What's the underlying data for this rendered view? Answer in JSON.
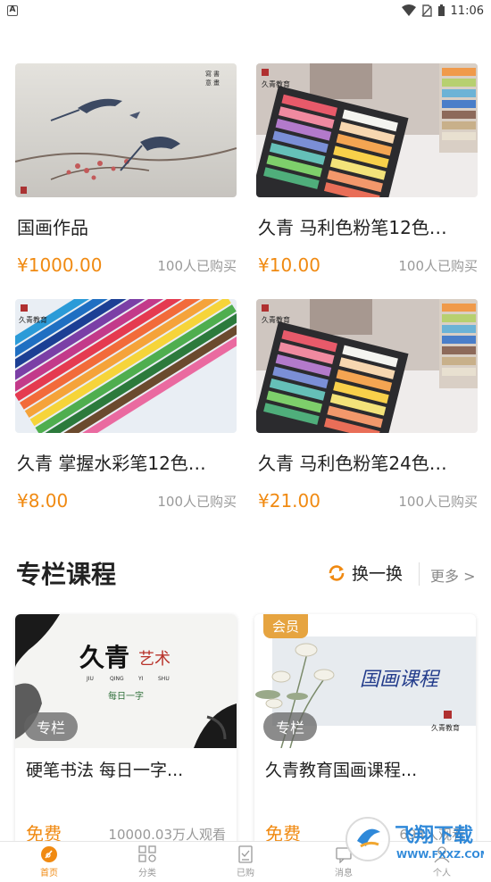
{
  "status_bar": {
    "time": "11:06",
    "left_icon": "A"
  },
  "products": [
    {
      "name": "国画作品",
      "price": "¥1000.00",
      "sold": "100人已购买"
    },
    {
      "name": "久青 马利色粉笔12色…",
      "price": "¥10.00",
      "sold": "100人已购买"
    },
    {
      "name": "久青 掌握水彩笔12色…",
      "price": "¥8.00",
      "sold": "100人已购买"
    },
    {
      "name": "久青 马利色粉笔24色…",
      "price": "¥21.00",
      "sold": "100人已购买"
    }
  ],
  "section": {
    "title": "专栏课程",
    "swap_label": "换一换",
    "more_label": "更多 >"
  },
  "courses": [
    {
      "title": "硬笔书法 每日一字...",
      "tag": "专栏",
      "price": "免费",
      "views": "10000.03万人观看",
      "thumb_texts": {
        "brand": "久青",
        "art": "艺术",
        "pinyin": [
          "JIU",
          "QING",
          "YI",
          "SHU"
        ],
        "sub": "每日一字"
      }
    },
    {
      "title": "久青教育国画课程...",
      "tag": "专栏",
      "vip": "会员",
      "price": "免费",
      "views": "694人观看",
      "thumb_texts": {
        "calligraphy": "国画课程",
        "seal": "久青教育"
      }
    }
  ],
  "bottom_nav": [
    {
      "label": "首页",
      "icon": "home-icon",
      "active": true
    },
    {
      "label": "分类",
      "icon": "category-grid-icon",
      "active": false
    },
    {
      "label": "已购",
      "icon": "purchased-icon",
      "active": false
    },
    {
      "label": "消息",
      "icon": "message-icon",
      "active": false
    },
    {
      "label": "个人",
      "icon": "profile-icon",
      "active": false
    }
  ],
  "watermark": {
    "text": "飞翔下载",
    "url": "WWW.FXXZ.COM"
  },
  "colors": {
    "accent": "#f08a12",
    "vip": "#e6a440",
    "text": "#222222",
    "muted": "#999999"
  }
}
